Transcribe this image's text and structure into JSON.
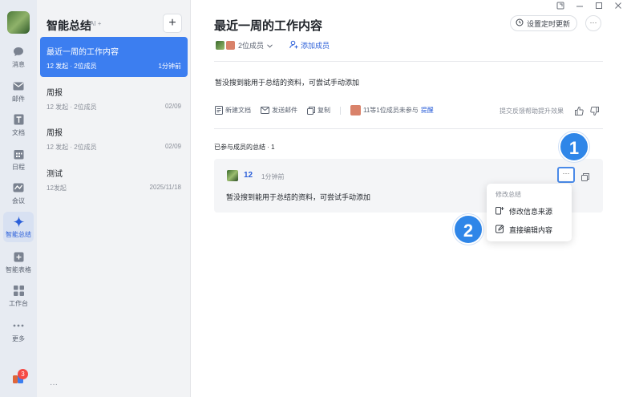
{
  "rail": {
    "items": [
      {
        "label": "消息",
        "icon": "message-icon"
      },
      {
        "label": "邮件",
        "icon": "mail-icon"
      },
      {
        "label": "文档",
        "icon": "doc-icon"
      },
      {
        "label": "日程",
        "icon": "calendar-icon"
      },
      {
        "label": "会议",
        "icon": "meeting-icon"
      },
      {
        "label": "智能总结",
        "icon": "sparkle-icon"
      },
      {
        "label": "智能表格",
        "icon": "smart-table-icon"
      },
      {
        "label": "工作台",
        "icon": "workbench-icon"
      },
      {
        "label": "更多",
        "icon": "more-icon"
      }
    ],
    "badge": "3",
    "accent": "#2b5fd9"
  },
  "list": {
    "title": "智能总结",
    "ai_tag": "AI +",
    "add": "+",
    "items": [
      {
        "title": "最近一周的工作内容",
        "meta": "12 发起 · 2位成员",
        "time": "1分钟前"
      },
      {
        "title": "周报",
        "meta": "12 发起 · 2位成员",
        "time": "02/09"
      },
      {
        "title": "周报",
        "meta": "12 发起 · 2位成员",
        "time": "02/09"
      },
      {
        "title": "测试",
        "meta": "12发起",
        "time": "2025/11/18"
      }
    ],
    "footer": "···",
    "active_color": "#3c7ef0"
  },
  "main": {
    "title": "最近一周的工作内容",
    "schedule_button": "设置定时更新",
    "more_button": "···",
    "members_label": "2位成员",
    "add_member": "添加成员",
    "empty_text": "暂没搜到能用于总结的资料，可尝试手动添加",
    "actions": {
      "new_doc": "新建文档",
      "send_mail": "发送邮件",
      "copy": "复制",
      "unjoined": "11等1位成员未参与",
      "remind": "提醒"
    },
    "feedback": "提交反馈帮助提升效果",
    "section_title": "已参与成员的总结 · 1",
    "card": {
      "user": "12",
      "time": "1分钟前",
      "text": "暂没搜到能用于总结的资料，可尝试手动添加",
      "dots": "···"
    },
    "menu": {
      "header": "修改总结",
      "items": [
        "修改信息来源",
        "直接编辑内容"
      ]
    },
    "steps": [
      "1",
      "2"
    ]
  }
}
